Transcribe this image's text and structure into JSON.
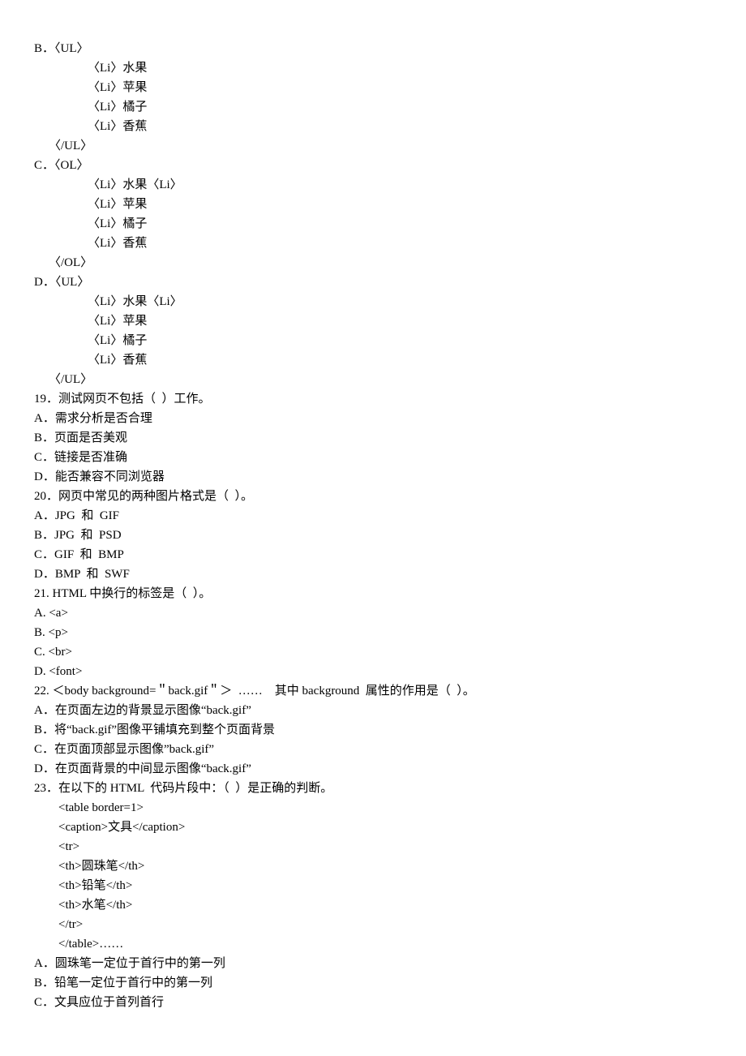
{
  "lines": [
    {
      "cls": "line",
      "text": "B．〈UL〉"
    },
    {
      "cls": "line indent2",
      "text": "〈Li〉水果"
    },
    {
      "cls": "line indent2",
      "text": "〈Li〉苹果"
    },
    {
      "cls": "line indent2",
      "text": "〈Li〉橘子"
    },
    {
      "cls": "line indent2",
      "text": "〈Li〉香蕉"
    },
    {
      "cls": "line indent1",
      "text": "〈/UL〉"
    },
    {
      "cls": "line",
      "text": "C．〈OL〉"
    },
    {
      "cls": "line indent2",
      "text": "〈Li〉水果〈Li〉"
    },
    {
      "cls": "line indent2",
      "text": "〈Li〉苹果"
    },
    {
      "cls": "line indent2",
      "text": "〈Li〉橘子"
    },
    {
      "cls": "line indent2",
      "text": "〈Li〉香蕉"
    },
    {
      "cls": "line indent1",
      "text": "〈/OL〉"
    },
    {
      "cls": "line",
      "text": "D．〈UL〉"
    },
    {
      "cls": "line indent2",
      "text": "〈Li〉水果〈Li〉"
    },
    {
      "cls": "line indent2",
      "text": "〈Li〉苹果"
    },
    {
      "cls": "line indent2",
      "text": "〈Li〉橘子"
    },
    {
      "cls": "line indent2",
      "text": "〈Li〉香蕉"
    },
    {
      "cls": "line indent1",
      "text": "〈/UL〉"
    },
    {
      "cls": "line",
      "text": "19．测试网页不包括（  ）工作。"
    },
    {
      "cls": "line",
      "text": "A．需求分析是否合理"
    },
    {
      "cls": "line",
      "text": "B．页面是否美观"
    },
    {
      "cls": "line",
      "text": "C．链接是否准确"
    },
    {
      "cls": "line",
      "text": "D．能否兼容不同浏览器"
    },
    {
      "cls": "line",
      "text": "20．网页中常见的两种图片格式是（  ）。"
    },
    {
      "cls": "line",
      "text": "A．JPG  和  GIF"
    },
    {
      "cls": "line",
      "text": "B．JPG  和  PSD"
    },
    {
      "cls": "line",
      "text": "C．GIF  和  BMP"
    },
    {
      "cls": "line",
      "text": "D．BMP  和  SWF"
    },
    {
      "cls": "line",
      "text": "21. HTML 中换行的标签是（  ）。"
    },
    {
      "cls": "line",
      "text": "A. <a>"
    },
    {
      "cls": "line",
      "text": "B. <p>"
    },
    {
      "cls": "line",
      "text": "C. <br>"
    },
    {
      "cls": "line",
      "text": "D. <font>"
    },
    {
      "cls": "line",
      "text": "22. ＜body background=＂back.gif＂＞  ……    其中 background  属性的作用是（  ）。"
    },
    {
      "cls": "line",
      "text": "A．在页面左边的背景显示图像“back.gif”"
    },
    {
      "cls": "line",
      "text": "B．将“back.gif”图像平铺填充到整个页面背景"
    },
    {
      "cls": "line",
      "text": "C．在页面顶部显示图像”back.gif”"
    },
    {
      "cls": "line",
      "text": "D．在页面背景的中间显示图像“back.gif”"
    },
    {
      "cls": "line",
      "text": "23．在以下的 HTML  代码片段中：（  ）是正确的判断。"
    },
    {
      "cls": "line",
      "text": "        <table border=1>"
    },
    {
      "cls": "line",
      "text": "        <caption>文具</caption>"
    },
    {
      "cls": "line",
      "text": "        <tr>"
    },
    {
      "cls": "line",
      "text": "        <th>圆珠笔</th>"
    },
    {
      "cls": "line",
      "text": "        <th>铅笔</th>"
    },
    {
      "cls": "line",
      "text": "        <th>水笔</th>"
    },
    {
      "cls": "line",
      "text": "        </tr>"
    },
    {
      "cls": "line",
      "text": "        </table>……"
    },
    {
      "cls": "line",
      "text": "A．圆珠笔一定位于首行中的第一列"
    },
    {
      "cls": "line",
      "text": "B．铅笔一定位于首行中的第一列"
    },
    {
      "cls": "line",
      "text": "C．文具应位于首列首行"
    }
  ]
}
